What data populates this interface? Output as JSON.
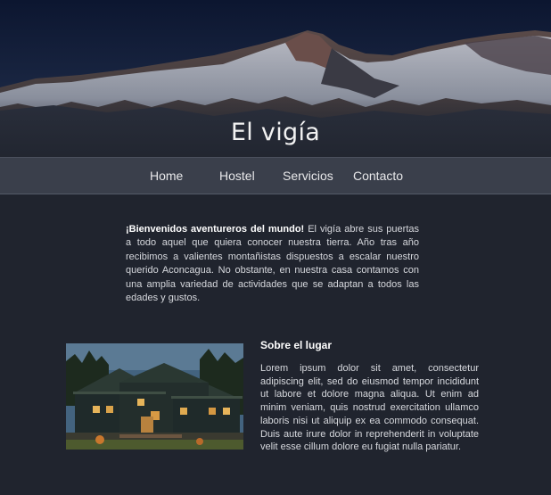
{
  "hero": {
    "title": "El vigía"
  },
  "nav": {
    "items": [
      {
        "label": "Home"
      },
      {
        "label": "Hostel"
      },
      {
        "label": "Servicios"
      },
      {
        "label": "Contacto"
      }
    ]
  },
  "intro": {
    "lead": "¡Bienvenidos aventureros del mundo!",
    "body": "El vigía abre sus puertas a todo aquel que quiera conocer nuestra tierra. Año tras año recibimos a valientes montañistas dispuestos a escalar nuestro querido Aconcagua. No obstante, en nuestra casa contamos con una amplia variedad de actividades que se adaptan a todos las edades y gustos."
  },
  "about": {
    "heading": "Sobre el lugar",
    "text": "Lorem ipsum dolor sit amet, consectetur adipiscing elit, sed do eiusmod tempor incididunt ut labore et dolore magna aliqua. Ut enim ad minim veniam, quis nostrud exercitation ullamco laboris nisi ut aliquip ex ea commodo consequat. Duis aute irure dolor in reprehenderit in voluptate velit esse cillum dolore eu fugiat nulla pariatur."
  }
}
